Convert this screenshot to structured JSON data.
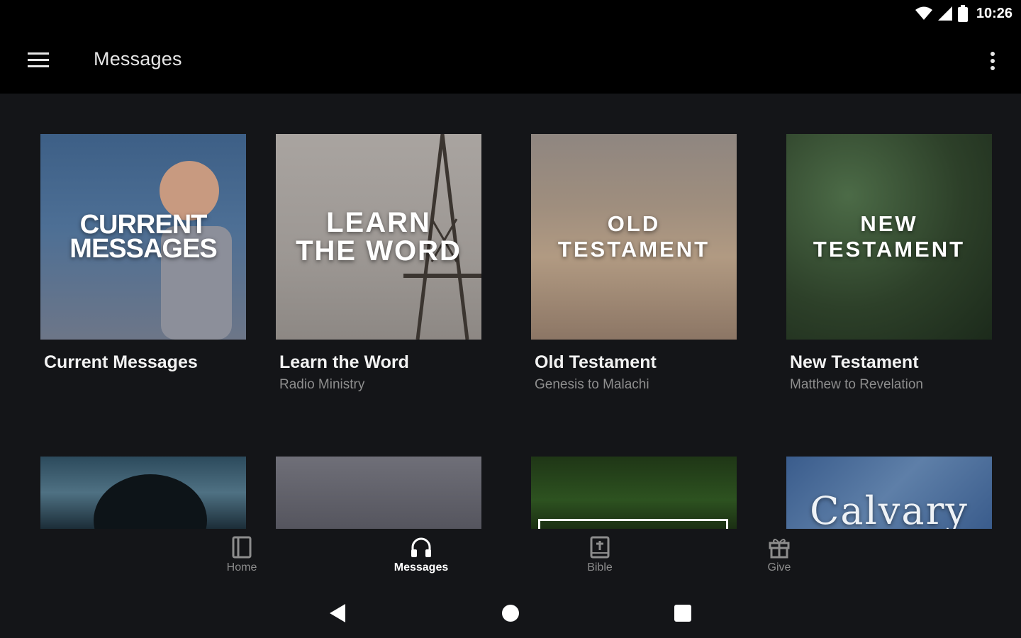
{
  "status_bar": {
    "time": "10:26"
  },
  "app_bar": {
    "title": "Messages"
  },
  "cards": [
    {
      "title": "Current Messages",
      "subtitle": "",
      "image_text": [
        "CURRENT",
        "MESSAGES"
      ]
    },
    {
      "title": "Learn the Word",
      "subtitle": "Radio Ministry",
      "image_text": [
        "LEARN",
        "THE WORD"
      ]
    },
    {
      "title": "Old Testament",
      "subtitle": "Genesis to Malachi",
      "image_text": [
        "OLD TESTAMENT"
      ]
    },
    {
      "title": "New Testament",
      "subtitle": "Matthew to Revelation",
      "image_text": [
        "NEW TESTAMENT"
      ]
    }
  ],
  "row2_image_text": {
    "calvary": "Calvary"
  },
  "bottom_nav": [
    {
      "label": "Home",
      "icon": "book-icon",
      "active": false
    },
    {
      "label": "Messages",
      "icon": "headphones-icon",
      "active": true
    },
    {
      "label": "Bible",
      "icon": "bible-icon",
      "active": false
    },
    {
      "label": "Give",
      "icon": "gift-icon",
      "active": false
    }
  ],
  "colors": {
    "background": "#141518",
    "app_bar": "#000000",
    "text_primary": "#f2f2f2",
    "text_secondary": "#8e8e8e",
    "nav_inactive": "#8d8d8d",
    "nav_active": "#ffffff"
  }
}
